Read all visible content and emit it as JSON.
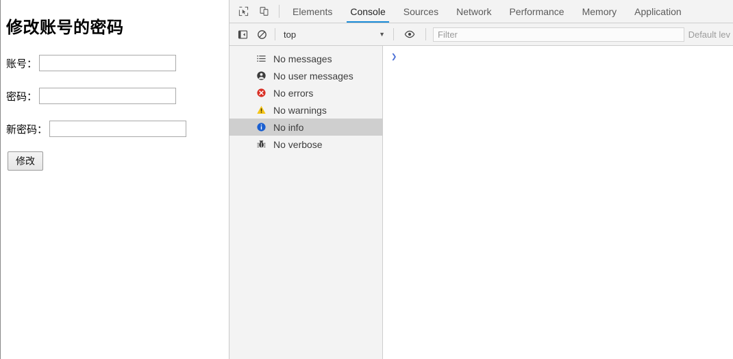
{
  "webpage": {
    "title": "修改账号的密码",
    "fields": [
      {
        "label": "账号：",
        "value": "",
        "placeholder": "",
        "name": "account"
      },
      {
        "label": "密码：",
        "value": "",
        "placeholder": "",
        "name": "password"
      },
      {
        "label": "新密码：",
        "value": "",
        "placeholder": "",
        "name": "new-password"
      }
    ],
    "submit_label": "修改"
  },
  "devtools": {
    "toolbar_icons": [
      {
        "name": "inspect-element-icon",
        "glyph": "inspect"
      },
      {
        "name": "device-toolbar-icon",
        "glyph": "device"
      }
    ],
    "tabs": [
      {
        "label": "Elements",
        "active": false
      },
      {
        "label": "Console",
        "active": true
      },
      {
        "label": "Sources",
        "active": false
      },
      {
        "label": "Network",
        "active": false
      },
      {
        "label": "Performance",
        "active": false
      },
      {
        "label": "Memory",
        "active": false
      },
      {
        "label": "Application",
        "active": false
      }
    ],
    "active_tab": "Console",
    "accent_color": "#1a8cd8",
    "console_toolbar": {
      "sidebar_toggle_name": "show-console-sidebar-icon",
      "clear_console_name": "clear-console-icon",
      "context": "top",
      "context_caret": "▼",
      "eye_icon_name": "live-expression-eye-icon",
      "filter_value": "",
      "filter_placeholder": "Filter",
      "levels_label": "Default lev"
    },
    "sidebar": {
      "items": [
        {
          "label": "No messages",
          "icon": "list-icon",
          "selected": false
        },
        {
          "label": "No user messages",
          "icon": "user-icon",
          "selected": false
        },
        {
          "label": "No errors",
          "icon": "error-icon",
          "selected": false
        },
        {
          "label": "No warnings",
          "icon": "warning-icon",
          "selected": false
        },
        {
          "label": "No info",
          "icon": "info-icon",
          "selected": true
        },
        {
          "label": "No verbose",
          "icon": "bug-icon",
          "selected": false
        }
      ],
      "selected_bg": "#cfcfcf"
    },
    "console_prompt": {
      "arrow": "❯",
      "input_value": ""
    },
    "status_colors": {
      "error": "#d93025",
      "warning": "#f5c518",
      "info": "#1a5fd0",
      "verbose": "#3c3c3c",
      "prompt": "#4b6fd6"
    }
  }
}
